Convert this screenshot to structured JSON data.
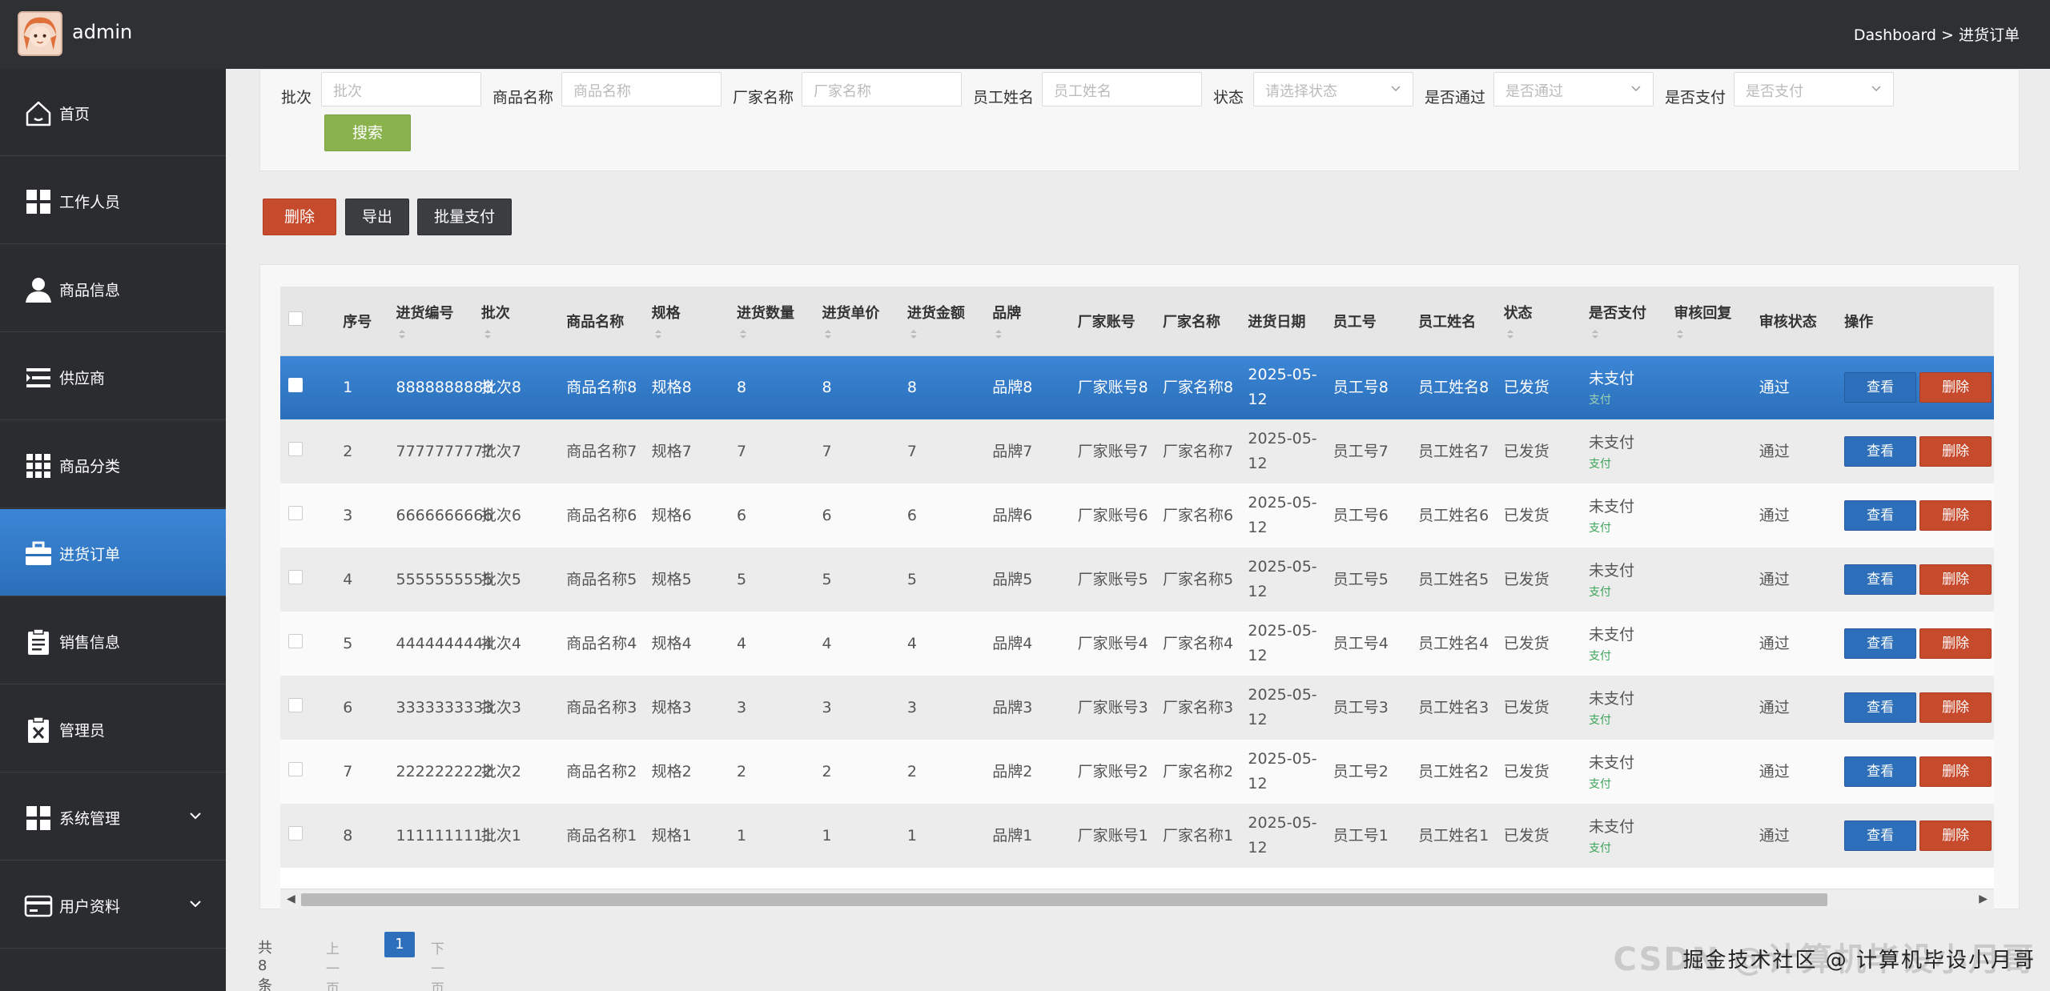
{
  "topbar": {
    "username": "admin",
    "breadcrumb": "Dashboard > 进货订单"
  },
  "sidebar": {
    "items": [
      {
        "label": "首页",
        "icon": "home-icon"
      },
      {
        "label": "工作人员",
        "icon": "grid-icon"
      },
      {
        "label": "商品信息",
        "icon": "user-icon"
      },
      {
        "label": "供应商",
        "icon": "list-icon"
      },
      {
        "label": "商品分类",
        "icon": "apps-icon"
      },
      {
        "label": "进货订单",
        "icon": "briefcase-icon",
        "active": true
      },
      {
        "label": "销售信息",
        "icon": "clipboard-icon"
      },
      {
        "label": "管理员",
        "icon": "clipboard-x-icon"
      },
      {
        "label": "系统管理",
        "icon": "grid-icon",
        "expandable": true
      },
      {
        "label": "用户资料",
        "icon": "card-icon",
        "expandable": true
      }
    ]
  },
  "search": {
    "batch_label": "批次",
    "batch_placeholder": "批次",
    "goods_label": "商品名称",
    "goods_placeholder": "商品名称",
    "vendor_label": "厂家名称",
    "vendor_placeholder": "厂家名称",
    "staff_label": "员工姓名",
    "staff_placeholder": "员工姓名",
    "status_label": "状态",
    "status_placeholder": "请选择状态",
    "passed_label": "是否通过",
    "passed_placeholder": "是否通过",
    "paid_label": "是否支付",
    "paid_placeholder": "是否支付",
    "search_button": "搜索"
  },
  "actions": {
    "delete": "删除",
    "export": "导出",
    "batch_pay": "批量支付"
  },
  "table": {
    "headers": [
      "序号",
      "进货编号",
      "批次",
      "商品名称",
      "规格",
      "进货数量",
      "进货单价",
      "进货金额",
      "品牌",
      "厂家账号",
      "厂家名称",
      "进货日期",
      "员工号",
      "员工姓名",
      "状态",
      "是否支付",
      "审核回复",
      "审核状态",
      "操作"
    ],
    "view_label": "查看",
    "delete_label": "删除",
    "rows": [
      {
        "no": "1",
        "code": "8888888888",
        "batch": "批次8",
        "goods": "商品名称8",
        "spec": "规格8",
        "qty": "8",
        "price": "8",
        "amount": "8",
        "brand": "品牌8",
        "vendor_acct": "厂家账号8",
        "vendor_name": "厂家名称8",
        "date": "2025-05-12",
        "staff_no": "员工号8",
        "staff_name": "员工姓名8",
        "status": "已发货",
        "paid": "未支付",
        "pay_link": "支付",
        "reply": "",
        "review": "通过"
      },
      {
        "no": "2",
        "code": "7777777777",
        "batch": "批次7",
        "goods": "商品名称7",
        "spec": "规格7",
        "qty": "7",
        "price": "7",
        "amount": "7",
        "brand": "品牌7",
        "vendor_acct": "厂家账号7",
        "vendor_name": "厂家名称7",
        "date": "2025-05-12",
        "staff_no": "员工号7",
        "staff_name": "员工姓名7",
        "status": "已发货",
        "paid": "未支付",
        "pay_link": "支付",
        "reply": "",
        "review": "通过"
      },
      {
        "no": "3",
        "code": "6666666666",
        "batch": "批次6",
        "goods": "商品名称6",
        "spec": "规格6",
        "qty": "6",
        "price": "6",
        "amount": "6",
        "brand": "品牌6",
        "vendor_acct": "厂家账号6",
        "vendor_name": "厂家名称6",
        "date": "2025-05-12",
        "staff_no": "员工号6",
        "staff_name": "员工姓名6",
        "status": "已发货",
        "paid": "未支付",
        "pay_link": "支付",
        "reply": "",
        "review": "通过"
      },
      {
        "no": "4",
        "code": "5555555555",
        "batch": "批次5",
        "goods": "商品名称5",
        "spec": "规格5",
        "qty": "5",
        "price": "5",
        "amount": "5",
        "brand": "品牌5",
        "vendor_acct": "厂家账号5",
        "vendor_name": "厂家名称5",
        "date": "2025-05-12",
        "staff_no": "员工号5",
        "staff_name": "员工姓名5",
        "status": "已发货",
        "paid": "未支付",
        "pay_link": "支付",
        "reply": "",
        "review": "通过"
      },
      {
        "no": "5",
        "code": "4444444444",
        "batch": "批次4",
        "goods": "商品名称4",
        "spec": "规格4",
        "qty": "4",
        "price": "4",
        "amount": "4",
        "brand": "品牌4",
        "vendor_acct": "厂家账号4",
        "vendor_name": "厂家名称4",
        "date": "2025-05-12",
        "staff_no": "员工号4",
        "staff_name": "员工姓名4",
        "status": "已发货",
        "paid": "未支付",
        "pay_link": "支付",
        "reply": "",
        "review": "通过"
      },
      {
        "no": "6",
        "code": "3333333333",
        "batch": "批次3",
        "goods": "商品名称3",
        "spec": "规格3",
        "qty": "3",
        "price": "3",
        "amount": "3",
        "brand": "品牌3",
        "vendor_acct": "厂家账号3",
        "vendor_name": "厂家名称3",
        "date": "2025-05-12",
        "staff_no": "员工号3",
        "staff_name": "员工姓名3",
        "status": "已发货",
        "paid": "未支付",
        "pay_link": "支付",
        "reply": "",
        "review": "通过"
      },
      {
        "no": "7",
        "code": "2222222222",
        "batch": "批次2",
        "goods": "商品名称2",
        "spec": "规格2",
        "qty": "2",
        "price": "2",
        "amount": "2",
        "brand": "品牌2",
        "vendor_acct": "厂家账号2",
        "vendor_name": "厂家名称2",
        "date": "2025-05-12",
        "staff_no": "员工号2",
        "staff_name": "员工姓名2",
        "status": "已发货",
        "paid": "未支付",
        "pay_link": "支付",
        "reply": "",
        "review": "通过"
      },
      {
        "no": "8",
        "code": "1111111111",
        "batch": "批次1",
        "goods": "商品名称1",
        "spec": "规格1",
        "qty": "1",
        "price": "1",
        "amount": "1",
        "brand": "品牌1",
        "vendor_acct": "厂家账号1",
        "vendor_name": "厂家名称1",
        "date": "2025-05-12",
        "staff_no": "员工号1",
        "staff_name": "员工姓名1",
        "status": "已发货",
        "paid": "未支付",
        "pay_link": "支付",
        "reply": "",
        "review": "通过"
      }
    ]
  },
  "pager": {
    "total": "共 8 条",
    "prev": "上一页",
    "current": "1",
    "next": "下一页"
  },
  "watermark": {
    "text": "CSDN @计算机毕设小月哥",
    "top": "掘金技术社区 @ 计算机毕设小月哥"
  },
  "colors": {
    "accent": "#2d6fba",
    "danger": "#c64a2c",
    "success": "#8ab34e",
    "topbar": "#2e3033"
  }
}
